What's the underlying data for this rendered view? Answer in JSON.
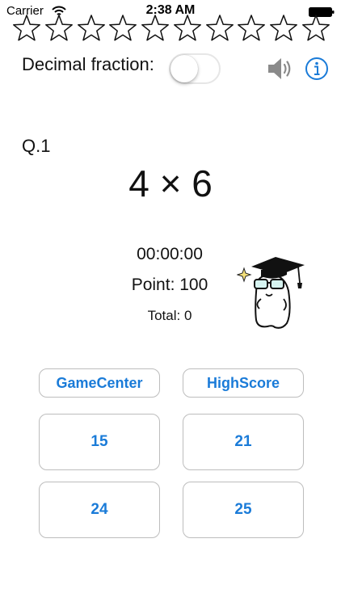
{
  "status_bar": {
    "carrier": "Carrier",
    "time": "2:38 AM"
  },
  "stars": {
    "count": 10,
    "filled": 0
  },
  "settings": {
    "decimal_fraction_label": "Decimal fraction:",
    "decimal_fraction_on": false
  },
  "question": {
    "number": "Q.1",
    "text": "4 × 6"
  },
  "stats": {
    "timer": "00:00:00",
    "points": "Point: 100",
    "total": "Total: 0"
  },
  "buttons": {
    "game_center": "GameCenter",
    "high_score": "HighScore"
  },
  "answers": [
    "15",
    "21",
    "24",
    "25"
  ],
  "colors": {
    "accent": "#1a7bd8",
    "border": "#bdbdbd"
  }
}
